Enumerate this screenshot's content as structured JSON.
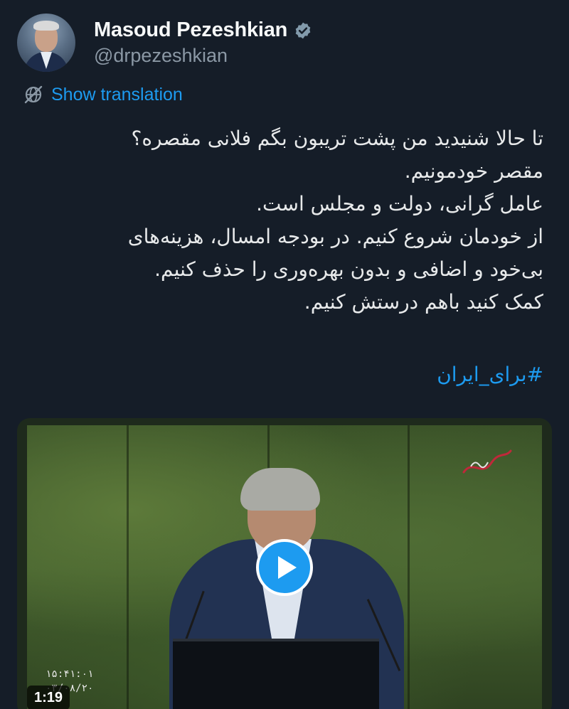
{
  "author": {
    "name": "Masoud Pezeshkian",
    "handle": "@drpezeshkian",
    "verified_icon": "verified-badge-icon"
  },
  "translation": {
    "label": "Show translation",
    "icon": "translate-globe-icon"
  },
  "post": {
    "lines": [
      "تا حالا شنیدید من پشت تریبون بگم فلانی مقصره؟",
      "مقصر خودمونیم.",
      "عامل گرانی، دولت و مجلس است.",
      "از خودمان شروع کنیم. در بودجه امسال، هزینه‌های",
      "بی‌خود و اضافی و بدون بهره‌وری را حذف کنیم.",
      "کمک کنید باهم درستش کنیم."
    ],
    "hashtag": "#برای_ایران"
  },
  "video": {
    "duration": "1:19",
    "timestamp_time": "۱۵:۴۱:۰۱",
    "timestamp_date": "۰۳/۰۸/۲۰",
    "play_icon": "play-icon"
  },
  "colors": {
    "background": "#151d28",
    "accent": "#1d9bf0",
    "text": "#e7e9ea",
    "secondary_text": "#8b98a5"
  }
}
